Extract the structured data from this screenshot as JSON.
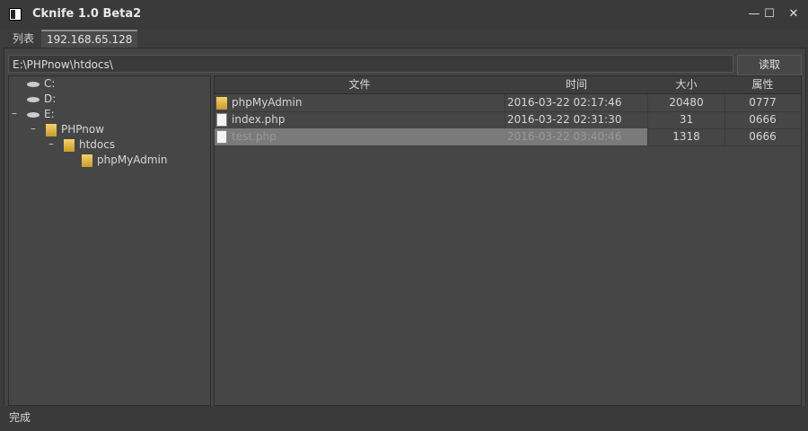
{
  "window": {
    "title": "Cknife 1.0 Beta2",
    "min_icon": "minimize-icon",
    "max_icon": "maximize-icon",
    "close_icon": "close-icon",
    "min_glyph": "—",
    "max_glyph": "☐",
    "close_glyph": "✕"
  },
  "tabs": [
    {
      "label": "列表"
    },
    {
      "label": "192.168.65.128"
    }
  ],
  "path_bar": {
    "value": "E:\\PHPnow\\htdocs\\",
    "read_label": "读取"
  },
  "tree": [
    {
      "label": "C:",
      "icon": "drive-icon",
      "toggle": ""
    },
    {
      "label": "D:",
      "icon": "drive-icon",
      "toggle": ""
    },
    {
      "label": "E:",
      "icon": "drive-icon",
      "toggle": "–"
    },
    {
      "label": "PHPnow",
      "icon": "folder-icon",
      "toggle": "–"
    },
    {
      "label": "htdocs",
      "icon": "folder-icon",
      "toggle": "–"
    },
    {
      "label": "phpMyAdmin",
      "icon": "folder-icon",
      "toggle": ""
    }
  ],
  "files": {
    "columns": [
      "文件",
      "时间",
      "大小",
      "属性"
    ],
    "rows": [
      {
        "name": "phpMyAdmin",
        "icon": "folder-icon",
        "date": "2016-03-22 02:17:46",
        "size": "20480",
        "attr": "0777"
      },
      {
        "name": "index.php",
        "icon": "file-icon",
        "date": "2016-03-22 02:31:30",
        "size": "31",
        "attr": "0666"
      },
      {
        "name": "test.php",
        "icon": "file-icon",
        "date": "2016-03-22 03:40:46",
        "size": "1318",
        "attr": "0666",
        "selected": true
      }
    ]
  },
  "status": "完成",
  "colors": {
    "background": "#3c3c3c",
    "panel": "#464646",
    "selection": "#7a7a7a",
    "folder": "#e6c04a"
  }
}
